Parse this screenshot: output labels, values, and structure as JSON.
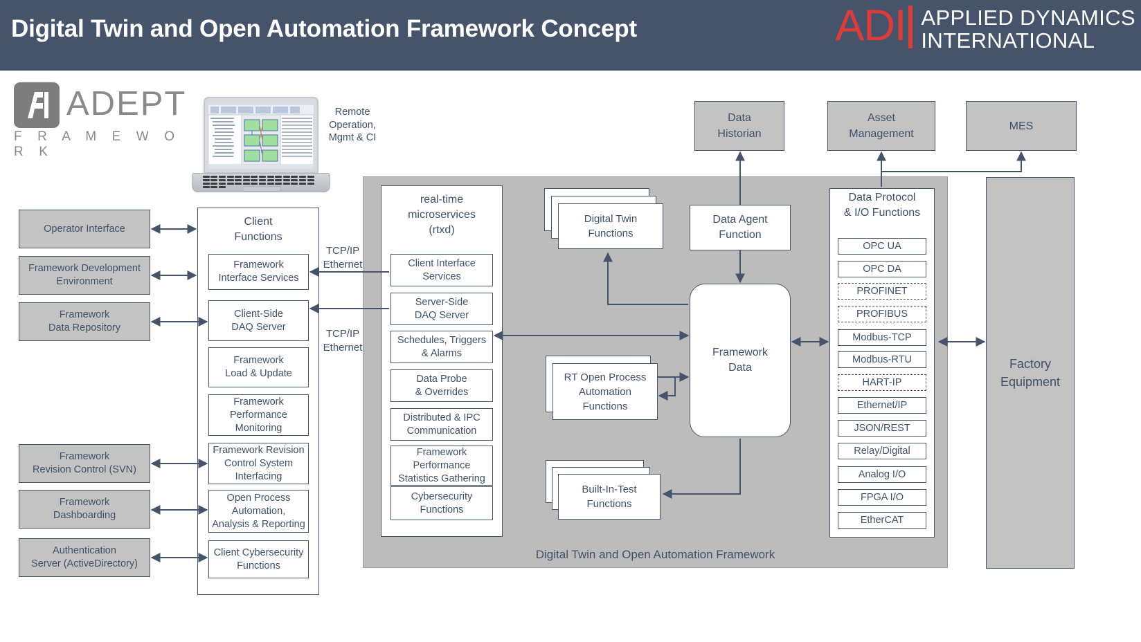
{
  "header": {
    "title": "Digital Twin and Open Automation Framework Concept",
    "logo_mark": "ADI",
    "logo_line1": "APPLIED DYNAMICS",
    "logo_line2": "INTERNATIONAL",
    "background_color": "#46546b",
    "accent_color": "#e03b3b"
  },
  "adept_logo": {
    "word": "ADEPT",
    "subtitle": "F R A M E W O R K"
  },
  "laptop": {
    "caption": "Remote\nOperation,\nMgmt & CI"
  },
  "left_column": {
    "items": [
      {
        "label": "Operator Interface"
      },
      {
        "label": "Framework Development\nEnvironment"
      },
      {
        "label": "Framework\nData Repository"
      },
      {
        "label": "Framework\nRevision Control (SVN)"
      },
      {
        "label": "Framework\nDashboarding"
      },
      {
        "label": "Authentication\nServer (ActiveDirectory)"
      }
    ]
  },
  "client_functions": {
    "title": "Client\nFunctions",
    "items": [
      {
        "label": "Framework\nInterface Services"
      },
      {
        "label": "Client-Side\nDAQ Server"
      },
      {
        "label": "Framework\nLoad & Update"
      },
      {
        "label": "Framework\nPerformance\nMonitoring"
      },
      {
        "label": "Framework Revision\nControl System\nInterfacing"
      },
      {
        "label": "Open Process\nAutomation,\nAnalysis & Reporting"
      },
      {
        "label": "Client Cybersecurity\nFunctions"
      }
    ]
  },
  "link_labels": {
    "top": "TCP/IP\nEthernet",
    "bottom": "TCP/IP\nEthernet"
  },
  "rtxd": {
    "title": "real-time\nmicroservices\n(rtxd)",
    "items": [
      {
        "label": "Client Interface\nServices"
      },
      {
        "label": "Server-Side\nDAQ Server"
      },
      {
        "label": "Schedules, Triggers\n& Alarms"
      },
      {
        "label": "Data Probe\n& Overrides"
      },
      {
        "label": "Distributed & IPC\nCommunication"
      },
      {
        "label": "Framework\nPerformance\nStatistics Gathering"
      },
      {
        "label": "Cybersecurity\nFunctions"
      }
    ]
  },
  "framework_panel": {
    "label": "Digital Twin and Open Automation Framework",
    "digital_twin": "Digital Twin\nFunctions",
    "data_agent": "Data Agent\nFunction",
    "framework_data": "Framework\nData",
    "rt_open_process": "RT Open Process\nAutomation\nFunctions",
    "built_in_test": "Built-In-Test\nFunctions"
  },
  "protocols": {
    "title": "Data Protocol\n& I/O Functions",
    "items": [
      {
        "label": "OPC UA",
        "style": "solid"
      },
      {
        "label": "OPC DA",
        "style": "solid"
      },
      {
        "label": "PROFINET",
        "style": "dashed"
      },
      {
        "label": "PROFIBUS",
        "style": "dashed"
      },
      {
        "label": "Modbus-TCP",
        "style": "solid"
      },
      {
        "label": "Modbus-RTU",
        "style": "solid"
      },
      {
        "label": "HART-IP",
        "style": "dashed"
      },
      {
        "label": "Ethernet/IP",
        "style": "solid"
      },
      {
        "label": "JSON/REST",
        "style": "solid"
      },
      {
        "label": "Relay/Digital",
        "style": "solid"
      },
      {
        "label": "Analog I/O",
        "style": "solid"
      },
      {
        "label": "FPGA I/O",
        "style": "solid"
      },
      {
        "label": "EtherCAT",
        "style": "solid"
      }
    ]
  },
  "external": {
    "data_historian": "Data\nHistorian",
    "asset_management": "Asset\nManagement",
    "mes": "MES",
    "factory_equipment": "Factory\nEquipment"
  }
}
